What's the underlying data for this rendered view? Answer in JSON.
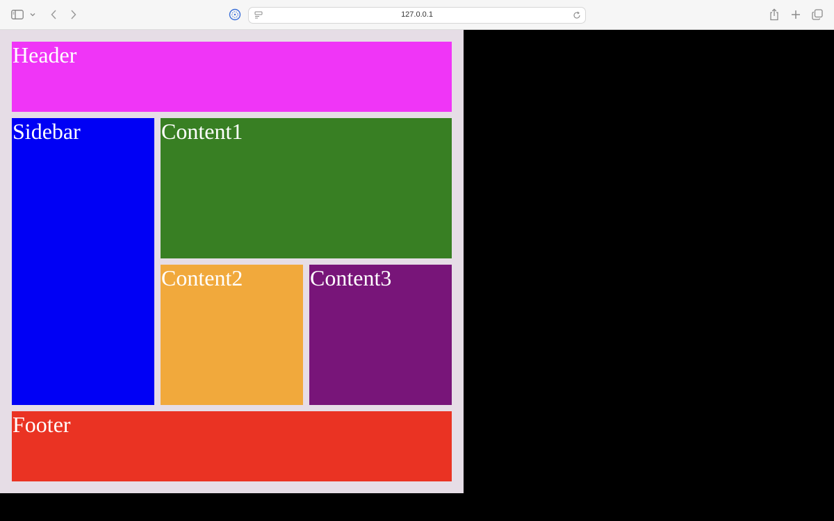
{
  "browser": {
    "url": "127.0.0.1",
    "icons": {
      "sidebar": "sidebar-icon",
      "tabs_menu": "chevron-down-icon",
      "back": "chevron-left-icon",
      "forward": "chevron-right-icon",
      "privacy": "privacy-report-icon",
      "page_menu": "page-menu-icon",
      "reload": "reload-icon",
      "share": "share-icon",
      "new_tab": "plus-icon",
      "tab_overview": "tab-overview-icon"
    }
  },
  "layout": {
    "header": {
      "label": "Header",
      "color": "#f035f7"
    },
    "sidebar": {
      "label": "Sidebar",
      "color": "#0000f5"
    },
    "content1": {
      "label": "Content1",
      "color": "#387f23"
    },
    "content2": {
      "label": "Content2",
      "color": "#f1a93c"
    },
    "content3": {
      "label": "Content3",
      "color": "#781579"
    },
    "footer": {
      "label": "Footer",
      "color": "#ea3323"
    }
  },
  "colors": {
    "page_background": "#e6dde6",
    "outside_background": "#000000",
    "text": "#ffffff"
  }
}
